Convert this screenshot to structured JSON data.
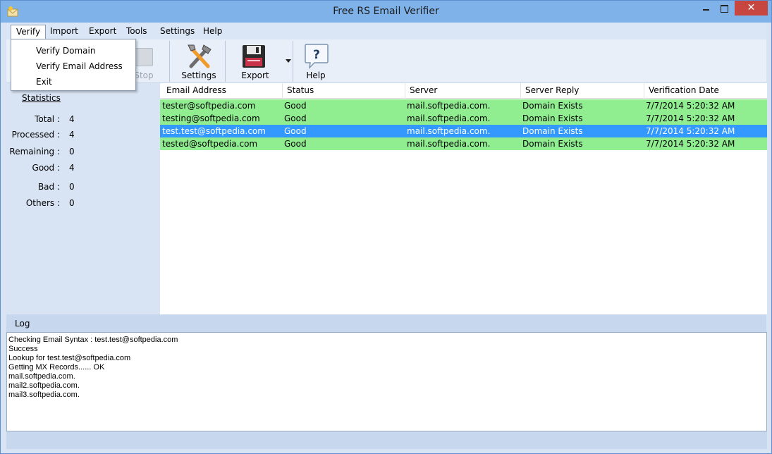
{
  "window": {
    "title": "Free RS Email Verifier",
    "close_glyph": "✕"
  },
  "menu": {
    "items": [
      "Verify",
      "Import",
      "Export",
      "Tools",
      "Settings",
      "Help"
    ],
    "open": "Verify",
    "dropdown": [
      "Verify Domain",
      "Verify Email Address",
      "Exit"
    ]
  },
  "toolbar": {
    "stop_label": "Stop",
    "settings_label": "Settings",
    "export_label": "Export",
    "help_label": "Help",
    "icons": {
      "settings": "tools-icon",
      "export": "floppy-disk-icon",
      "help": "help-question-icon"
    }
  },
  "stats": {
    "title": "Statistics",
    "rows": [
      {
        "label": "Total :",
        "value": "4"
      },
      {
        "label": "Processed :",
        "value": "4"
      },
      {
        "label": "Remaining :",
        "value": "0"
      },
      {
        "label": "Good :",
        "value": "4"
      },
      {
        "label": "Bad :",
        "value": "0"
      },
      {
        "label": "Others :",
        "value": "0"
      }
    ]
  },
  "grid": {
    "columns": [
      "Email Address",
      "Status",
      "Server",
      "Server Reply",
      "Verification Date"
    ],
    "rows": [
      {
        "email": "tester@softpedia.com",
        "status": "Good",
        "server": "mail.softpedia.com.",
        "reply": "Domain Exists",
        "date": "7/7/2014 5:20:32 AM",
        "selected": false
      },
      {
        "email": "testing@softpedia.com",
        "status": "Good",
        "server": "mail.softpedia.com.",
        "reply": "Domain Exists",
        "date": "7/7/2014 5:20:32 AM",
        "selected": false
      },
      {
        "email": "test.test@softpedia.com",
        "status": "Good",
        "server": "mail.softpedia.com.",
        "reply": "Domain Exists",
        "date": "7/7/2014 5:20:32 AM",
        "selected": true
      },
      {
        "email": "tested@softpedia.com",
        "status": "Good",
        "server": "mail.softpedia.com.",
        "reply": "Domain Exists",
        "date": "7/7/2014 5:20:32 AM",
        "selected": false
      }
    ],
    "colors": {
      "good": "#90ee90",
      "selected": "#3399ff"
    }
  },
  "log": {
    "label": "Log",
    "lines": [
      "Checking Email Syntax : test.test@softpedia.com",
      "Success",
      "Lookup for test.test@softpedia.com",
      "Getting MX Records...... OK",
      "mail.softpedia.com.",
      "mail2.softpedia.com.",
      "mail3.softpedia.com."
    ]
  }
}
